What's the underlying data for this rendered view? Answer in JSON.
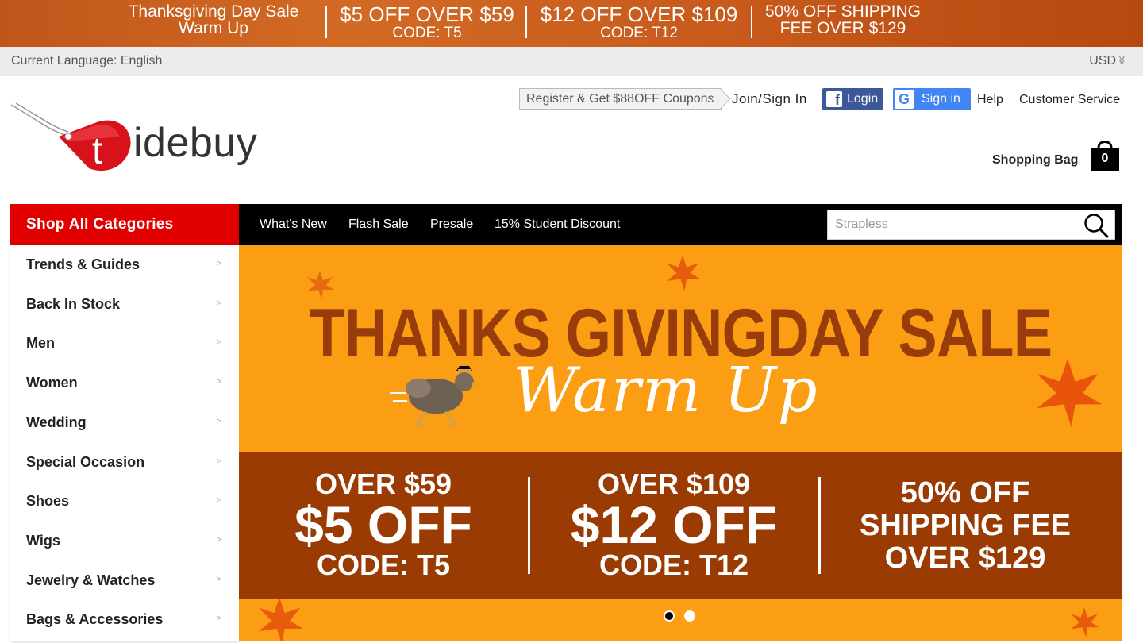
{
  "promo": {
    "sale_line1": "Thanksgiving Day Sale",
    "sale_line2": "Warm Up",
    "offer1_line1": "$5 OFF OVER $59",
    "offer1_line2": "CODE: T5",
    "offer2_line1": "$12 OFF OVER $109",
    "offer2_line2": "CODE: T12",
    "offer3_line1": "50% OFF SHIPPING",
    "offer3_line2": "FEE OVER $129"
  },
  "lang_bar": {
    "language": "Current Language: English",
    "currency": "USD",
    "currency_chevron": "≫"
  },
  "header": {
    "logo_text": "idebuy",
    "logo_letter": "t",
    "register_coupon": "Register & Get $88OFF Coupons",
    "join": "Join/Sign In",
    "facebook_login": "Login",
    "google_signin": "Sign in",
    "help": "Help",
    "customer_service": "Customer Service",
    "bag_label": "Shopping Bag",
    "bag_count": "0"
  },
  "nav": {
    "shop_all": "Shop All Categories",
    "items": [
      "What's New",
      "Flash Sale",
      "Presale",
      "15% Student Discount"
    ],
    "search_placeholder": "Strapless"
  },
  "categories": [
    {
      "label": "Trends & Guides"
    },
    {
      "label": "Back In Stock"
    },
    {
      "label": "Men"
    },
    {
      "label": "Women"
    },
    {
      "label": "Wedding"
    },
    {
      "label": "Special Occasion"
    },
    {
      "label": "Shoes"
    },
    {
      "label": "Wigs"
    },
    {
      "label": "Jewelry & Watches"
    },
    {
      "label": "Bags & Accessories"
    }
  ],
  "category_chevron": ">",
  "banner": {
    "title": "THANKS GIVINGDAY SALE",
    "subtitle": "Warm Up",
    "offer1": {
      "top": "OVER $59",
      "main": "$5 OFF",
      "code": "CODE: T5"
    },
    "offer2": {
      "top": "OVER $109",
      "main": "$12 OFF",
      "code": "CODE: T12"
    },
    "offer3": {
      "line1": "50% OFF",
      "line2": "SHIPPING FEE",
      "line3": "OVER $129"
    },
    "slides": 2,
    "active_slide": 1
  },
  "colors": {
    "promo_bg": "#c95c1d",
    "shop_all_bg": "#e00000",
    "nav_bg": "#000000",
    "banner_bg": "#fc9e13",
    "banner_strip": "#993b02",
    "facebook": "#3b5998",
    "google": "#4285f4"
  }
}
